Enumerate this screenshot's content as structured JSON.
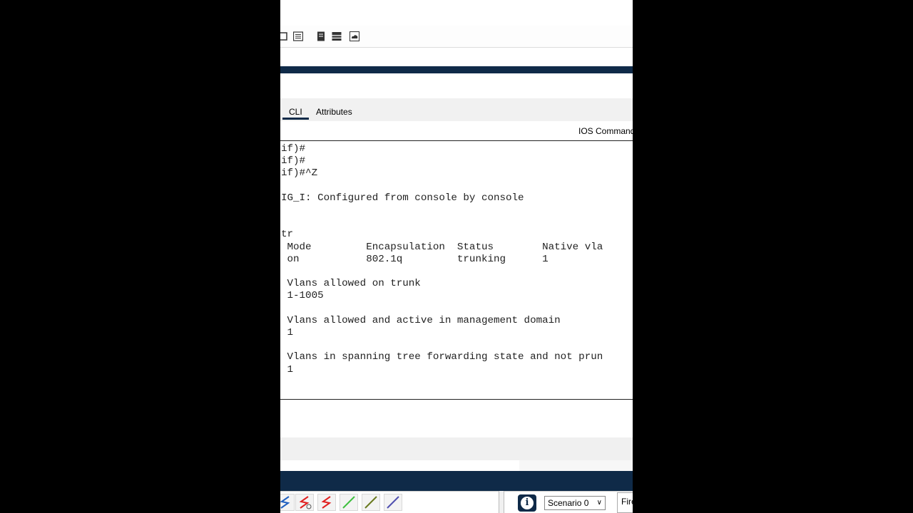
{
  "tabs": {
    "cli": "CLI",
    "attributes": "Attributes"
  },
  "ios_commands_label": "IOS Command",
  "terminal": {
    "lines": [
      "if)#",
      "if)#",
      "if)#^Z",
      "",
      "IG_I: Configured from console by console",
      "",
      "",
      "tr",
      " Mode         Encapsulation  Status        Native vla",
      " on           802.1q         trunking      1",
      "",
      " Vlans allowed on trunk",
      " 1-1005",
      "",
      " Vlans allowed and active in management domain",
      " 1",
      "",
      " Vlans in spanning tree forwarding state and not prun",
      " 1"
    ]
  },
  "bottom_bar": {
    "info_symbol": "i",
    "scenario": "Scenario 0",
    "scenario_chevron": "∨",
    "fire": "Fire"
  },
  "colors": {
    "accent": "#0f2a48",
    "cable_blue": "#2060c0",
    "cable_red": "#e02020",
    "cable_green": "#40c040",
    "cable_olive": "#6a7a20",
    "cable_purple": "#5050b0"
  }
}
